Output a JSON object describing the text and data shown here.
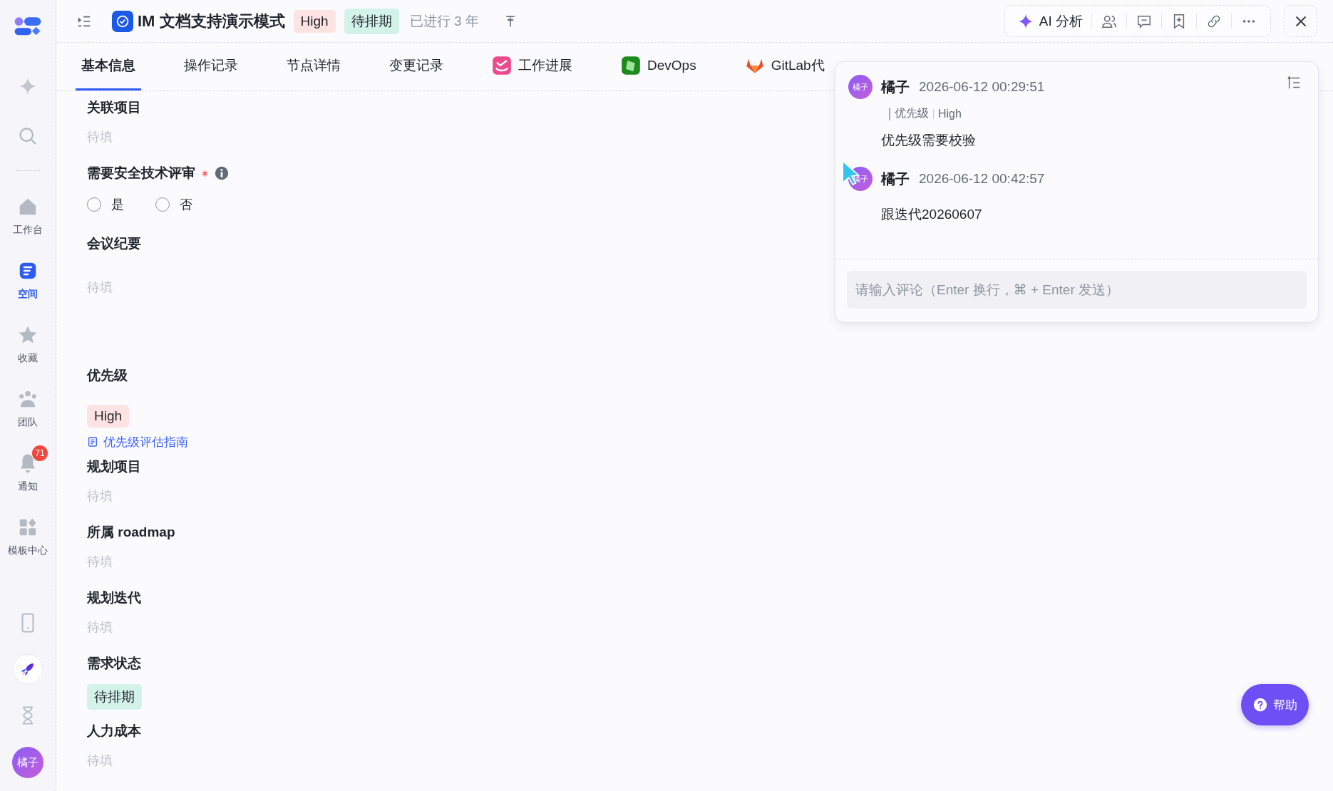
{
  "sidebar": {
    "items": [
      {
        "label": "工作台",
        "selected": false
      },
      {
        "label": "空间",
        "selected": true
      },
      {
        "label": "收藏",
        "selected": false
      },
      {
        "label": "团队",
        "selected": false
      },
      {
        "label": "通知",
        "selected": false,
        "badge": "71"
      },
      {
        "label": "模板中心",
        "selected": false
      }
    ],
    "avatar": "橘子"
  },
  "header": {
    "title": "IM 文档支持演示模式",
    "tags": [
      {
        "text": "High",
        "color": "#fde3e3"
      },
      {
        "text": "待排期",
        "color": "#d3f3e9"
      }
    ],
    "status": "已进行 3 年",
    "ai_button": "AI 分析"
  },
  "tabs": [
    {
      "label": "基本信息",
      "selected": true
    },
    {
      "label": "操作记录",
      "selected": false
    },
    {
      "label": "节点详情",
      "selected": false
    },
    {
      "label": "变更记录",
      "selected": false
    },
    {
      "label": "工作进展",
      "selected": false
    },
    {
      "label": "DevOps",
      "selected": false
    },
    {
      "label": "GitLab代",
      "selected": false
    }
  ],
  "fields": [
    {
      "kind": "text",
      "label": "关联项目",
      "placeholder": "待填"
    },
    {
      "kind": "radio",
      "label": "需要安全技术评审",
      "required": true,
      "options": [
        {
          "label": "是",
          "selected": false
        },
        {
          "label": "否",
          "selected": false
        }
      ]
    },
    {
      "kind": "multiline",
      "label": "会议纪要",
      "placeholder": "待填"
    },
    {
      "kind": "tag",
      "label": "优先级",
      "tag": "High",
      "color": "#fde3e3",
      "link": "优先级评估指南"
    },
    {
      "kind": "text",
      "label": "规划项目",
      "placeholder": "待填"
    },
    {
      "kind": "text",
      "label": "所属 roadmap",
      "placeholder": "待填"
    },
    {
      "kind": "text",
      "label": "规划迭代",
      "placeholder": "待填"
    },
    {
      "kind": "tag",
      "label": "需求状态",
      "tag": "待排期",
      "color": "#d3f3e9"
    },
    {
      "kind": "text",
      "label": "人力成本",
      "placeholder": "待填"
    }
  ],
  "comments": {
    "items": [
      {
        "avatar": "橘子",
        "author": "橘子",
        "time": "2026-06-12 00:29:51",
        "change": {
          "field": "优先级",
          "value": "High"
        },
        "body": "优先级需要校验"
      },
      {
        "avatar": "橘子",
        "author": "橘子",
        "time": "2026-06-12 00:42:57",
        "body": "跟迭代20260607"
      }
    ],
    "input": {
      "placeholder": "请输入评论（Enter 换行，⌘ + Enter 发送）"
    }
  },
  "help": {
    "label": "帮助"
  }
}
